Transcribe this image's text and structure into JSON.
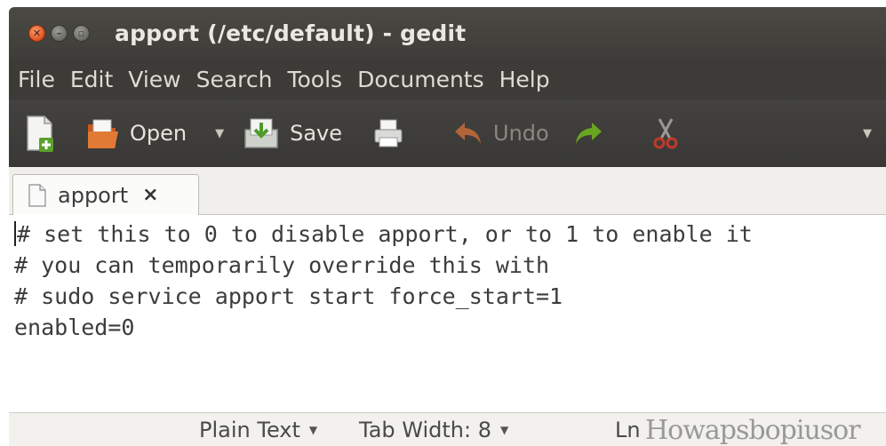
{
  "window": {
    "title": "apport (/etc/default) - gedit"
  },
  "menu": {
    "items": [
      "File",
      "Edit",
      "View",
      "Search",
      "Tools",
      "Documents",
      "Help"
    ]
  },
  "toolbar": {
    "open_label": "Open",
    "save_label": "Save",
    "undo_label": "Undo",
    "icons": [
      "new-document-icon",
      "open-folder-icon",
      "save-icon",
      "print-icon",
      "undo-icon",
      "redo-icon",
      "cut-icon"
    ]
  },
  "tabs": [
    {
      "label": "apport",
      "close": "×"
    }
  ],
  "editor": {
    "lines": [
      "# set this to 0 to disable apport, or to 1 to enable it",
      "# you can temporarily override this with",
      "# sudo service apport start force_start=1",
      "enabled=0"
    ]
  },
  "statusbar": {
    "language": "Plain Text",
    "tab_width": "Tab Width: 8",
    "position_prefix": "Ln",
    "watermark": "Howapsbopiusor"
  },
  "colors": {
    "titlebar": "#3e3d39",
    "close_button": "#e0531e",
    "undo_arrow": "#d9733a",
    "redo_arrow": "#6aa521"
  }
}
